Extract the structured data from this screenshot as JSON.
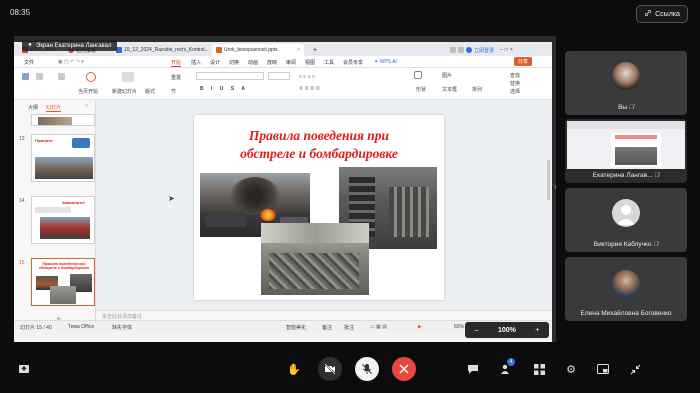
{
  "status": {
    "time": "08:35"
  },
  "header": {
    "link_label": "Ссылка"
  },
  "screen_share": {
    "presenter_label": "Экран Екатерина Лангавал",
    "wps": {
      "tabs": [
        {
          "label": "WPS Office"
        },
        {
          "label": "稻壳模板"
        },
        {
          "label": "10_12_2024_Razvitie_rechi_Kontrol..."
        },
        {
          "label": "Urok_bezopasnosti.pptx"
        }
      ],
      "new_tab": "+",
      "login_label": "立即登录",
      "menu": [
        "文件",
        "开始",
        "插入",
        "设计",
        "切换",
        "动画",
        "放映",
        "审阅",
        "视图",
        "工具",
        "会员专享"
      ],
      "menu_active": "开始",
      "wps_ai": "WPS AI",
      "share_label": "分享",
      "ribbon_labels": [
        "当页开始",
        "新建幻灯片",
        "版式",
        "节",
        "重置",
        "形状",
        "图片",
        "文本框",
        "排列",
        "查找",
        "替换",
        "选择"
      ],
      "pane_tabs": [
        "大纲",
        "幻灯片"
      ],
      "thumbs": [
        {
          "num": "13",
          "title": "Помните:"
        },
        {
          "num": "14",
          "title": "Запомните!"
        },
        {
          "num": "15",
          "title": "Правила поведения при обстреле и бомбардировке"
        }
      ],
      "slide": {
        "title_line1": "Правила поведения при",
        "title_line2": "обстреле и бомбардировке"
      },
      "notes_placeholder": "单击此处添加备注",
      "status": {
        "slide_counter": "幻灯片 15 / 40",
        "theme": "Тема Office",
        "font_missing": "缺失字体",
        "smart_beautify": "智能美化",
        "notes": "备注",
        "comment": "批注",
        "zoom": "65%"
      }
    },
    "zoom_overlay": {
      "minus": "–",
      "value": "100%",
      "plus": "+"
    }
  },
  "participants": [
    {
      "name": "Вы",
      "muted": true
    },
    {
      "name": "Екатерина Лангав...",
      "muted": true
    },
    {
      "name": "Виктория Каблучко",
      "muted": true
    },
    {
      "name": "Елена Михайловна Боговенко",
      "muted": false
    }
  ],
  "controls": {
    "participants_badge": "4"
  },
  "colors": {
    "accent_red": "#e5483f",
    "slide_title": "#e41a1a",
    "wps_orange": "#e0602a"
  }
}
